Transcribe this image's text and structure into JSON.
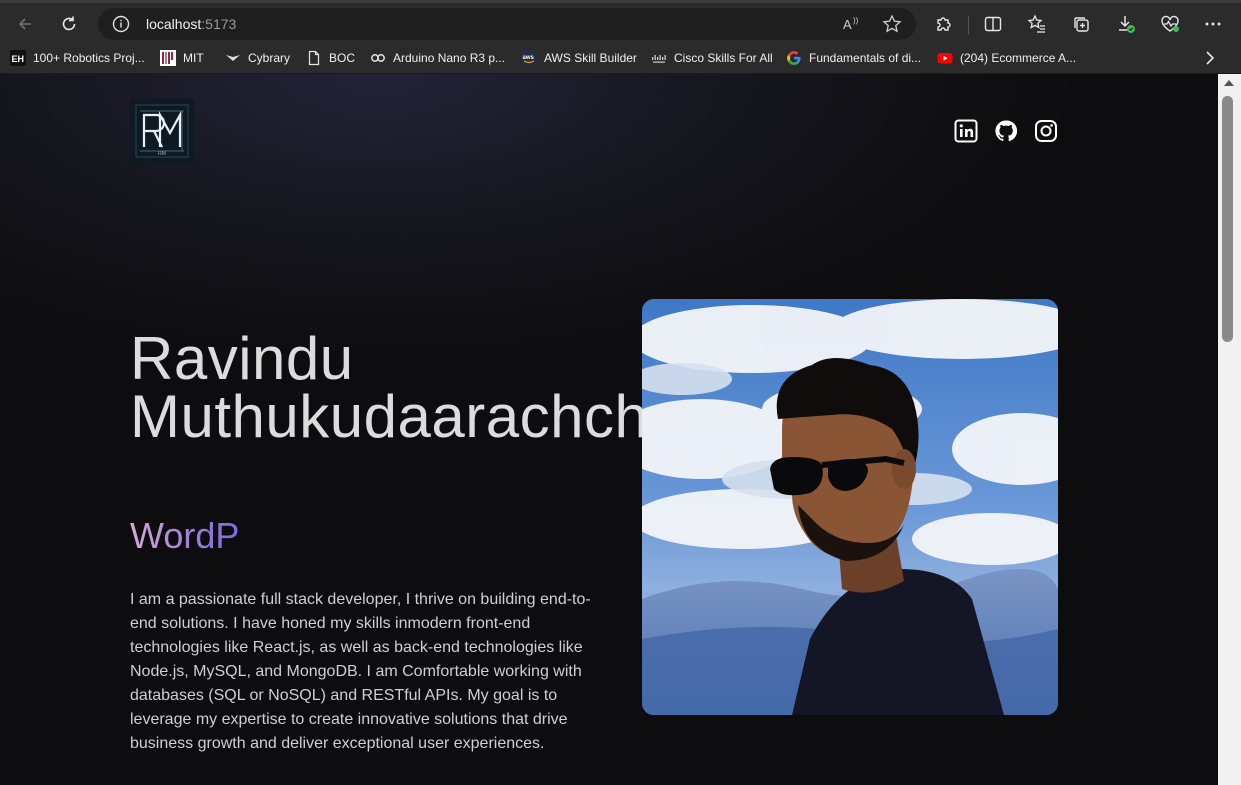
{
  "browser": {
    "url_host": "localhost",
    "url_port": ":5173",
    "bookmarks": [
      {
        "label": "100+ Robotics Proj...",
        "icon": "eh-icon"
      },
      {
        "label": "MIT",
        "icon": "mit-icon"
      },
      {
        "label": "Cybrary",
        "icon": "cybrary-icon"
      },
      {
        "label": "BOC",
        "icon": "page-icon"
      },
      {
        "label": "Arduino Nano R3 p...",
        "icon": "arduino-icon"
      },
      {
        "label": "AWS Skill Builder",
        "icon": "aws-icon"
      },
      {
        "label": "Cisco Skills For All",
        "icon": "cisco-icon"
      },
      {
        "label": "Fundamentals of di...",
        "icon": "google-icon"
      },
      {
        "label": "(204) Ecommerce A...",
        "icon": "youtube-icon"
      }
    ]
  },
  "page": {
    "logo_text": "RM",
    "social": [
      "linkedin-icon",
      "github-icon",
      "instagram-icon"
    ],
    "name_first": "Ravindu",
    "name_last": "Muthukudaarachchi",
    "typing_text": "WordP",
    "bio": "I am a passionate full stack developer, I thrive on building end-to-end solutions. I have honed my skills inmodern front-end technologies like React.js, as well as back-end technologies like Node.js, MySQL, and MongoDB. I am Comfortable working with databases (SQL or NoSQL) and RESTful APIs. My goal is to leverage my expertise to create innovative solutions that drive business growth and deliver exceptional user experiences.",
    "colors": {
      "background": "#0d0d0f",
      "accent_gradient_start": "#d8a6d9",
      "accent_gradient_end": "#7b6ae0"
    }
  }
}
